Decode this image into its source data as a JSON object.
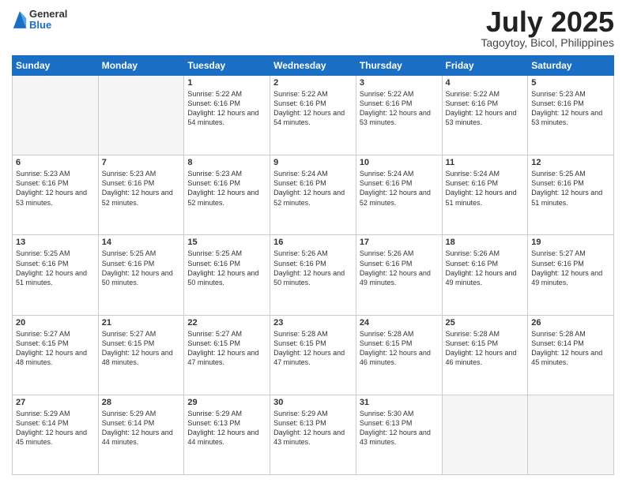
{
  "header": {
    "logo_general": "General",
    "logo_blue": "Blue",
    "title": "July 2025",
    "location": "Tagoytoy, Bicol, Philippines"
  },
  "days_of_week": [
    "Sunday",
    "Monday",
    "Tuesday",
    "Wednesday",
    "Thursday",
    "Friday",
    "Saturday"
  ],
  "weeks": [
    [
      {
        "day": "",
        "empty": true
      },
      {
        "day": "",
        "empty": true
      },
      {
        "day": "1",
        "sunrise": "5:22 AM",
        "sunset": "6:16 PM",
        "daylight": "12 hours and 54 minutes."
      },
      {
        "day": "2",
        "sunrise": "5:22 AM",
        "sunset": "6:16 PM",
        "daylight": "12 hours and 54 minutes."
      },
      {
        "day": "3",
        "sunrise": "5:22 AM",
        "sunset": "6:16 PM",
        "daylight": "12 hours and 53 minutes."
      },
      {
        "day": "4",
        "sunrise": "5:22 AM",
        "sunset": "6:16 PM",
        "daylight": "12 hours and 53 minutes."
      },
      {
        "day": "5",
        "sunrise": "5:23 AM",
        "sunset": "6:16 PM",
        "daylight": "12 hours and 53 minutes."
      }
    ],
    [
      {
        "day": "6",
        "sunrise": "5:23 AM",
        "sunset": "6:16 PM",
        "daylight": "12 hours and 53 minutes."
      },
      {
        "day": "7",
        "sunrise": "5:23 AM",
        "sunset": "6:16 PM",
        "daylight": "12 hours and 52 minutes."
      },
      {
        "day": "8",
        "sunrise": "5:23 AM",
        "sunset": "6:16 PM",
        "daylight": "12 hours and 52 minutes."
      },
      {
        "day": "9",
        "sunrise": "5:24 AM",
        "sunset": "6:16 PM",
        "daylight": "12 hours and 52 minutes."
      },
      {
        "day": "10",
        "sunrise": "5:24 AM",
        "sunset": "6:16 PM",
        "daylight": "12 hours and 52 minutes."
      },
      {
        "day": "11",
        "sunrise": "5:24 AM",
        "sunset": "6:16 PM",
        "daylight": "12 hours and 51 minutes."
      },
      {
        "day": "12",
        "sunrise": "5:25 AM",
        "sunset": "6:16 PM",
        "daylight": "12 hours and 51 minutes."
      }
    ],
    [
      {
        "day": "13",
        "sunrise": "5:25 AM",
        "sunset": "6:16 PM",
        "daylight": "12 hours and 51 minutes."
      },
      {
        "day": "14",
        "sunrise": "5:25 AM",
        "sunset": "6:16 PM",
        "daylight": "12 hours and 50 minutes."
      },
      {
        "day": "15",
        "sunrise": "5:25 AM",
        "sunset": "6:16 PM",
        "daylight": "12 hours and 50 minutes."
      },
      {
        "day": "16",
        "sunrise": "5:26 AM",
        "sunset": "6:16 PM",
        "daylight": "12 hours and 50 minutes."
      },
      {
        "day": "17",
        "sunrise": "5:26 AM",
        "sunset": "6:16 PM",
        "daylight": "12 hours and 49 minutes."
      },
      {
        "day": "18",
        "sunrise": "5:26 AM",
        "sunset": "6:16 PM",
        "daylight": "12 hours and 49 minutes."
      },
      {
        "day": "19",
        "sunrise": "5:27 AM",
        "sunset": "6:16 PM",
        "daylight": "12 hours and 49 minutes."
      }
    ],
    [
      {
        "day": "20",
        "sunrise": "5:27 AM",
        "sunset": "6:15 PM",
        "daylight": "12 hours and 48 minutes."
      },
      {
        "day": "21",
        "sunrise": "5:27 AM",
        "sunset": "6:15 PM",
        "daylight": "12 hours and 48 minutes."
      },
      {
        "day": "22",
        "sunrise": "5:27 AM",
        "sunset": "6:15 PM",
        "daylight": "12 hours and 47 minutes."
      },
      {
        "day": "23",
        "sunrise": "5:28 AM",
        "sunset": "6:15 PM",
        "daylight": "12 hours and 47 minutes."
      },
      {
        "day": "24",
        "sunrise": "5:28 AM",
        "sunset": "6:15 PM",
        "daylight": "12 hours and 46 minutes."
      },
      {
        "day": "25",
        "sunrise": "5:28 AM",
        "sunset": "6:15 PM",
        "daylight": "12 hours and 46 minutes."
      },
      {
        "day": "26",
        "sunrise": "5:28 AM",
        "sunset": "6:14 PM",
        "daylight": "12 hours and 45 minutes."
      }
    ],
    [
      {
        "day": "27",
        "sunrise": "5:29 AM",
        "sunset": "6:14 PM",
        "daylight": "12 hours and 45 minutes."
      },
      {
        "day": "28",
        "sunrise": "5:29 AM",
        "sunset": "6:14 PM",
        "daylight": "12 hours and 44 minutes."
      },
      {
        "day": "29",
        "sunrise": "5:29 AM",
        "sunset": "6:13 PM",
        "daylight": "12 hours and 44 minutes."
      },
      {
        "day": "30",
        "sunrise": "5:29 AM",
        "sunset": "6:13 PM",
        "daylight": "12 hours and 43 minutes."
      },
      {
        "day": "31",
        "sunrise": "5:30 AM",
        "sunset": "6:13 PM",
        "daylight": "12 hours and 43 minutes."
      },
      {
        "day": "",
        "empty": true
      },
      {
        "day": "",
        "empty": true
      }
    ]
  ]
}
